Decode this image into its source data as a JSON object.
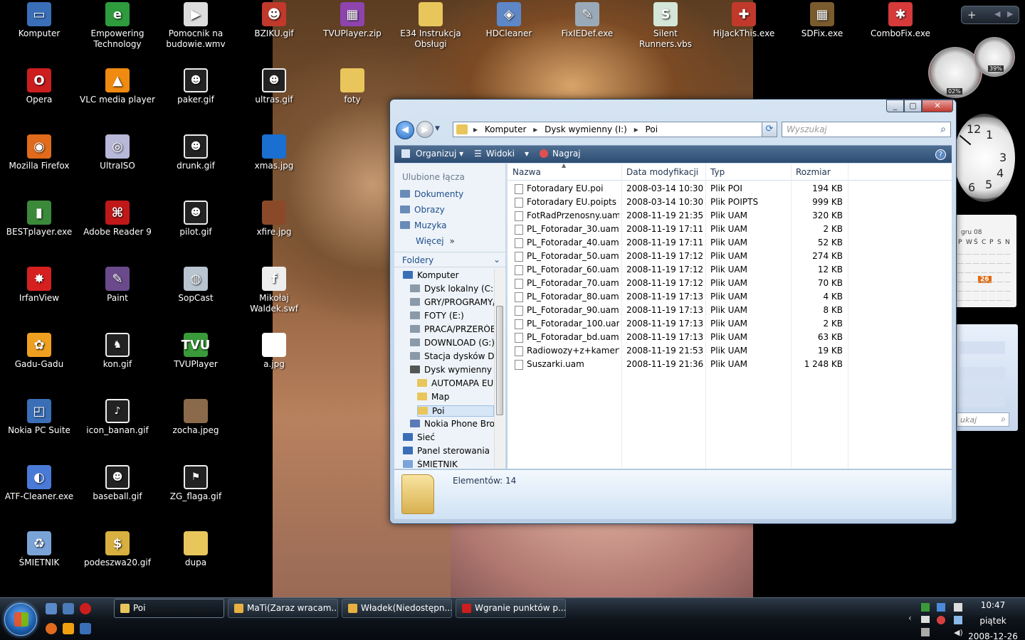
{
  "desktop_icons": [
    {
      "label": "Komputer",
      "color": "#3a6fb8",
      "glyph": "▭"
    },
    {
      "label": "Empowering Technology",
      "color": "#2e9b3c",
      "glyph": "e"
    },
    {
      "label": "Pomocnik na budowie.wmv",
      "color": "#dcdcdc",
      "glyph": "▶"
    },
    {
      "label": "BZIKU.gif",
      "color": "#c0392b",
      "glyph": "☻"
    },
    {
      "label": "TVUPlayer.zip",
      "color": "#8e44ad",
      "glyph": "▦"
    },
    {
      "label": "E34 Instrukcja Obsługi",
      "color": "#e8c65c",
      "glyph": ""
    },
    {
      "label": "HDCleaner",
      "color": "#5d87c7",
      "glyph": "◈"
    },
    {
      "label": "FixIEDef.exe",
      "color": "#9aa9b8",
      "glyph": "✎"
    },
    {
      "label": "Silent Runners.vbs",
      "color": "#d4e6d8",
      "glyph": "S"
    },
    {
      "label": "HiJackThis.exe",
      "color": "#c0392b",
      "glyph": "✚"
    },
    {
      "label": "SDFix.exe",
      "color": "#7a5b2e",
      "glyph": "▦"
    },
    {
      "label": "ComboFix.exe",
      "color": "#d63a3a",
      "glyph": "✱"
    },
    {
      "label": "Opera",
      "color": "#cc1e1e",
      "glyph": "O"
    },
    {
      "label": "VLC media player",
      "color": "#f08a10",
      "glyph": "▲"
    },
    {
      "label": "paker.gif",
      "color": "#222",
      "glyph": "☻"
    },
    {
      "label": "ultras.gif",
      "color": "#222",
      "glyph": "☻"
    },
    {
      "label": "foty",
      "color": "#e8c65c",
      "glyph": ""
    },
    {
      "label": "Mozilla Firefox",
      "color": "#e06b1c",
      "glyph": "◉"
    },
    {
      "label": "UltraISO",
      "color": "#b8b8d8",
      "glyph": "◎"
    },
    {
      "label": "drunk.gif",
      "color": "#222",
      "glyph": "☻"
    },
    {
      "label": "xmas.jpg",
      "color": "#1a6fd0",
      "glyph": ""
    },
    {
      "label": "BESTplayer.exe",
      "color": "#3a8a3a",
      "glyph": "▮"
    },
    {
      "label": "Adobe Reader 9",
      "color": "#c01818",
      "glyph": "⌘"
    },
    {
      "label": "pilot.gif",
      "color": "#222",
      "glyph": "☻"
    },
    {
      "label": "xfire.jpg",
      "color": "#8a4a2a",
      "glyph": ""
    },
    {
      "label": "IrfanView",
      "color": "#d62020",
      "glyph": "✸"
    },
    {
      "label": "Paint",
      "color": "#6a4a8a",
      "glyph": "✎"
    },
    {
      "label": "SopCast",
      "color": "#b8c4d0",
      "glyph": "◍"
    },
    {
      "label": "Mikołaj Waldek.swf",
      "color": "#eeeeee",
      "glyph": "f"
    },
    {
      "label": "Gadu-Gadu",
      "color": "#f0a020",
      "glyph": "✿"
    },
    {
      "label": "kon.gif",
      "color": "#222",
      "glyph": "♞"
    },
    {
      "label": "TVUPlayer",
      "color": "#3a9a3a",
      "glyph": "TVU"
    },
    {
      "label": "a.jpg",
      "color": "#ffffff",
      "glyph": ""
    },
    {
      "label": "Nokia PC Suite",
      "color": "#3a6fb8",
      "glyph": "◰"
    },
    {
      "label": "icon_banan.gif",
      "color": "#222",
      "glyph": "♪"
    },
    {
      "label": "zocha.jpeg",
      "color": "#8a6a4a",
      "glyph": ""
    },
    {
      "label": "ATF-Cleaner.exe",
      "color": "#4a7ad8",
      "glyph": "◐"
    },
    {
      "label": "baseball.gif",
      "color": "#222",
      "glyph": "☻"
    },
    {
      "label": "ZG_flaga.gif",
      "color": "#222",
      "glyph": "⚑"
    },
    {
      "label": "ŚMIETNIK",
      "color": "#7aa4d8",
      "glyph": "♻"
    },
    {
      "label": "podeszwa20.gif",
      "color": "#d8b040",
      "glyph": "$"
    },
    {
      "label": "dupa",
      "color": "#e8c65c",
      "glyph": ""
    }
  ],
  "window": {
    "minimize": "_",
    "maximize": "▢",
    "close": "✕",
    "address": [
      "Komputer",
      "Dysk wymienny (I:)",
      "Poi"
    ],
    "search_placeholder": "Wyszukaj",
    "toolbar": {
      "organize": "Organizuj",
      "views": "Widoki",
      "burn": "Nagraj",
      "help": "?"
    },
    "favorites_heading": "Ulubione łącza",
    "favorites": [
      "Dokumenty",
      "Obrazy",
      "Muzyka",
      "Więcej"
    ],
    "more_arrows": "»",
    "folders_heading": "Foldery",
    "tree": [
      {
        "label": "Komputer",
        "indent": 0,
        "color": "#3a6fb8"
      },
      {
        "label": "Dysk lokalny (C:)",
        "indent": 1,
        "color": "#8a9aa8"
      },
      {
        "label": "GRY/PROGRAMY/...",
        "indent": 1,
        "color": "#8a9aa8"
      },
      {
        "label": "FOTY (E:)",
        "indent": 1,
        "color": "#8a9aa8"
      },
      {
        "label": "PRACA/PRZERÓBKI",
        "indent": 1,
        "color": "#8a9aa8"
      },
      {
        "label": "DOWNLOAD (G:)",
        "indent": 1,
        "color": "#8a9aa8"
      },
      {
        "label": "Stacja dysków DVD",
        "indent": 1,
        "color": "#8a9aa8"
      },
      {
        "label": "Dysk wymienny (I:)",
        "indent": 1,
        "color": "#555"
      },
      {
        "label": "AUTOMAPA EU",
        "indent": 2,
        "color": "#e8c65c"
      },
      {
        "label": "Map",
        "indent": 2,
        "color": "#e8c65c"
      },
      {
        "label": "Poi",
        "indent": 2,
        "color": "#e8c65c"
      },
      {
        "label": "Nokia Phone Browser",
        "indent": 1,
        "color": "#5a7ab8"
      },
      {
        "label": "Sieć",
        "indent": 0,
        "color": "#3a6fb8"
      },
      {
        "label": "Panel sterowania",
        "indent": 0,
        "color": "#3a6fb8"
      },
      {
        "label": "ŚMIETNIK",
        "indent": 0,
        "color": "#7aa4d8"
      }
    ],
    "columns": {
      "name": "Nazwa",
      "date": "Data modyfikacji",
      "type": "Typ",
      "size": "Rozmiar"
    },
    "files": [
      {
        "name": "Fotoradary EU.poi",
        "date": "2008-03-14 10:30",
        "type": "Plik POI",
        "size": "194 KB"
      },
      {
        "name": "Fotoradary EU.poipts",
        "date": "2008-03-14 10:30",
        "type": "Plik POIPTS",
        "size": "999 KB"
      },
      {
        "name": "FotRadPrzenosny.uam",
        "date": "2008-11-19 21:35",
        "type": "Plik UAM",
        "size": "320 KB"
      },
      {
        "name": "PL_Fotoradar_30.uam",
        "date": "2008-11-19 17:11",
        "type": "Plik UAM",
        "size": "2 KB"
      },
      {
        "name": "PL_Fotoradar_40.uam",
        "date": "2008-11-19 17:11",
        "type": "Plik UAM",
        "size": "52 KB"
      },
      {
        "name": "PL_Fotoradar_50.uam",
        "date": "2008-11-19 17:12",
        "type": "Plik UAM",
        "size": "274 KB"
      },
      {
        "name": "PL_Fotoradar_60.uam",
        "date": "2008-11-19 17:12",
        "type": "Plik UAM",
        "size": "12 KB"
      },
      {
        "name": "PL_Fotoradar_70.uam",
        "date": "2008-11-19 17:12",
        "type": "Plik UAM",
        "size": "70 KB"
      },
      {
        "name": "PL_Fotoradar_80.uam",
        "date": "2008-11-19 17:13",
        "type": "Plik UAM",
        "size": "4 KB"
      },
      {
        "name": "PL_Fotoradar_90.uam",
        "date": "2008-11-19 17:13",
        "type": "Plik UAM",
        "size": "8 KB"
      },
      {
        "name": "PL_Fotoradar_100.uam",
        "date": "2008-11-19 17:13",
        "type": "Plik UAM",
        "size": "2 KB"
      },
      {
        "name": "PL_Fotoradar_bd.uam",
        "date": "2008-11-19 17:13",
        "type": "Plik UAM",
        "size": "63 KB"
      },
      {
        "name": "Radiowozy+z+kamer%...",
        "date": "2008-11-19 21:53",
        "type": "Plik UAM",
        "size": "19 KB"
      },
      {
        "name": "Suszarki.uam",
        "date": "2008-11-19 21:36",
        "type": "Plik UAM",
        "size": "1 248 KB"
      }
    ],
    "status": "Elementów: 14"
  },
  "taskbar": {
    "tasks": [
      {
        "label": "Poi",
        "color": "#e8c65c",
        "active": true
      },
      {
        "label": "MaTi(Zaraz wracam...",
        "color": "#e8b040",
        "active": false
      },
      {
        "label": "Władek(Niedostępn...",
        "color": "#e8b040",
        "active": false
      },
      {
        "label": "Wgranie punktów p...",
        "color": "#cc1e1e",
        "active": false
      }
    ],
    "time": "10:47",
    "day": "piątek",
    "date": "2008-12-26"
  },
  "gadgets": {
    "cpu_percent": "02%",
    "mem_percent": "39%",
    "calendar_month": "gru 08",
    "calendar_days": [
      "P",
      "W",
      "Ś",
      "C",
      "P",
      "S",
      "N"
    ],
    "today": "26",
    "feed_search_placeholder": "ukaj",
    "clock_numbers": [
      "12",
      "1",
      "3",
      "4",
      "5",
      "6"
    ]
  }
}
